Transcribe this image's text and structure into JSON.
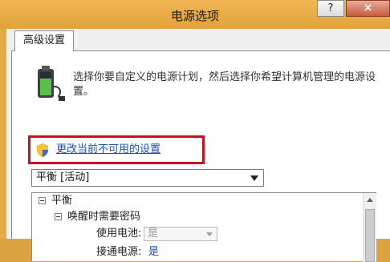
{
  "window": {
    "title": "电源选项",
    "help_label": "?",
    "close_label": "×"
  },
  "tabs": [
    {
      "label": "高级设置"
    }
  ],
  "description": "选择你要自定义的电源计划，然后选择你希望计算机管理的电源设置。",
  "change_settings_link": "更改当前不可用的设置",
  "plan_select": {
    "value": "平衡 [活动]"
  },
  "tree": {
    "root": "平衡",
    "child": "唤醒时需要密码",
    "on_battery_label": "使用电池:",
    "on_battery_value": "是",
    "plugged_in_label": "接通电源:",
    "plugged_in_value": "是"
  },
  "colors": {
    "accent_frame": "#e6aa43",
    "link": "#1f4fb4",
    "highlight": "#c8101e",
    "close": "#c45a3d"
  },
  "icons": [
    "battery-power-icon",
    "shield-icon",
    "chevron-down-icon",
    "help-icon",
    "close-icon"
  ]
}
